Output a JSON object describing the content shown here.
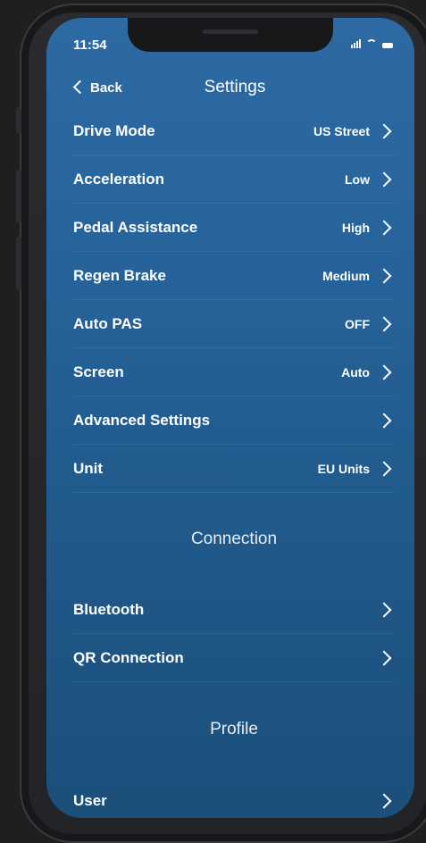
{
  "status": {
    "time": "11:54"
  },
  "nav": {
    "back_label": "Back",
    "title": "Settings"
  },
  "settings_rows": [
    {
      "label": "Drive Mode",
      "value": "US Street"
    },
    {
      "label": "Acceleration",
      "value": "Low"
    },
    {
      "label": "Pedal Assistance",
      "value": "High"
    },
    {
      "label": "Regen Brake",
      "value": "Medium"
    },
    {
      "label": "Auto PAS",
      "value": "OFF"
    },
    {
      "label": "Screen",
      "value": "Auto"
    },
    {
      "label": "Advanced Settings",
      "value": ""
    },
    {
      "label": "Unit",
      "value": "EU Units"
    }
  ],
  "connection": {
    "title": "Connection",
    "rows": [
      {
        "label": "Bluetooth"
      },
      {
        "label": "QR Connection"
      }
    ]
  },
  "profile": {
    "title": "Profile",
    "rows": [
      {
        "label": "User"
      }
    ]
  },
  "icons": {
    "back": "chevron-left-icon",
    "row_chevron": "chevron-right-icon",
    "signal": "cellular-signal-icon",
    "wifi": "wifi-icon",
    "battery": "battery-icon"
  },
  "colors": {
    "background_top": "#2d6aa4",
    "background_bottom": "#1c4f7a",
    "text": "#ffffff"
  }
}
